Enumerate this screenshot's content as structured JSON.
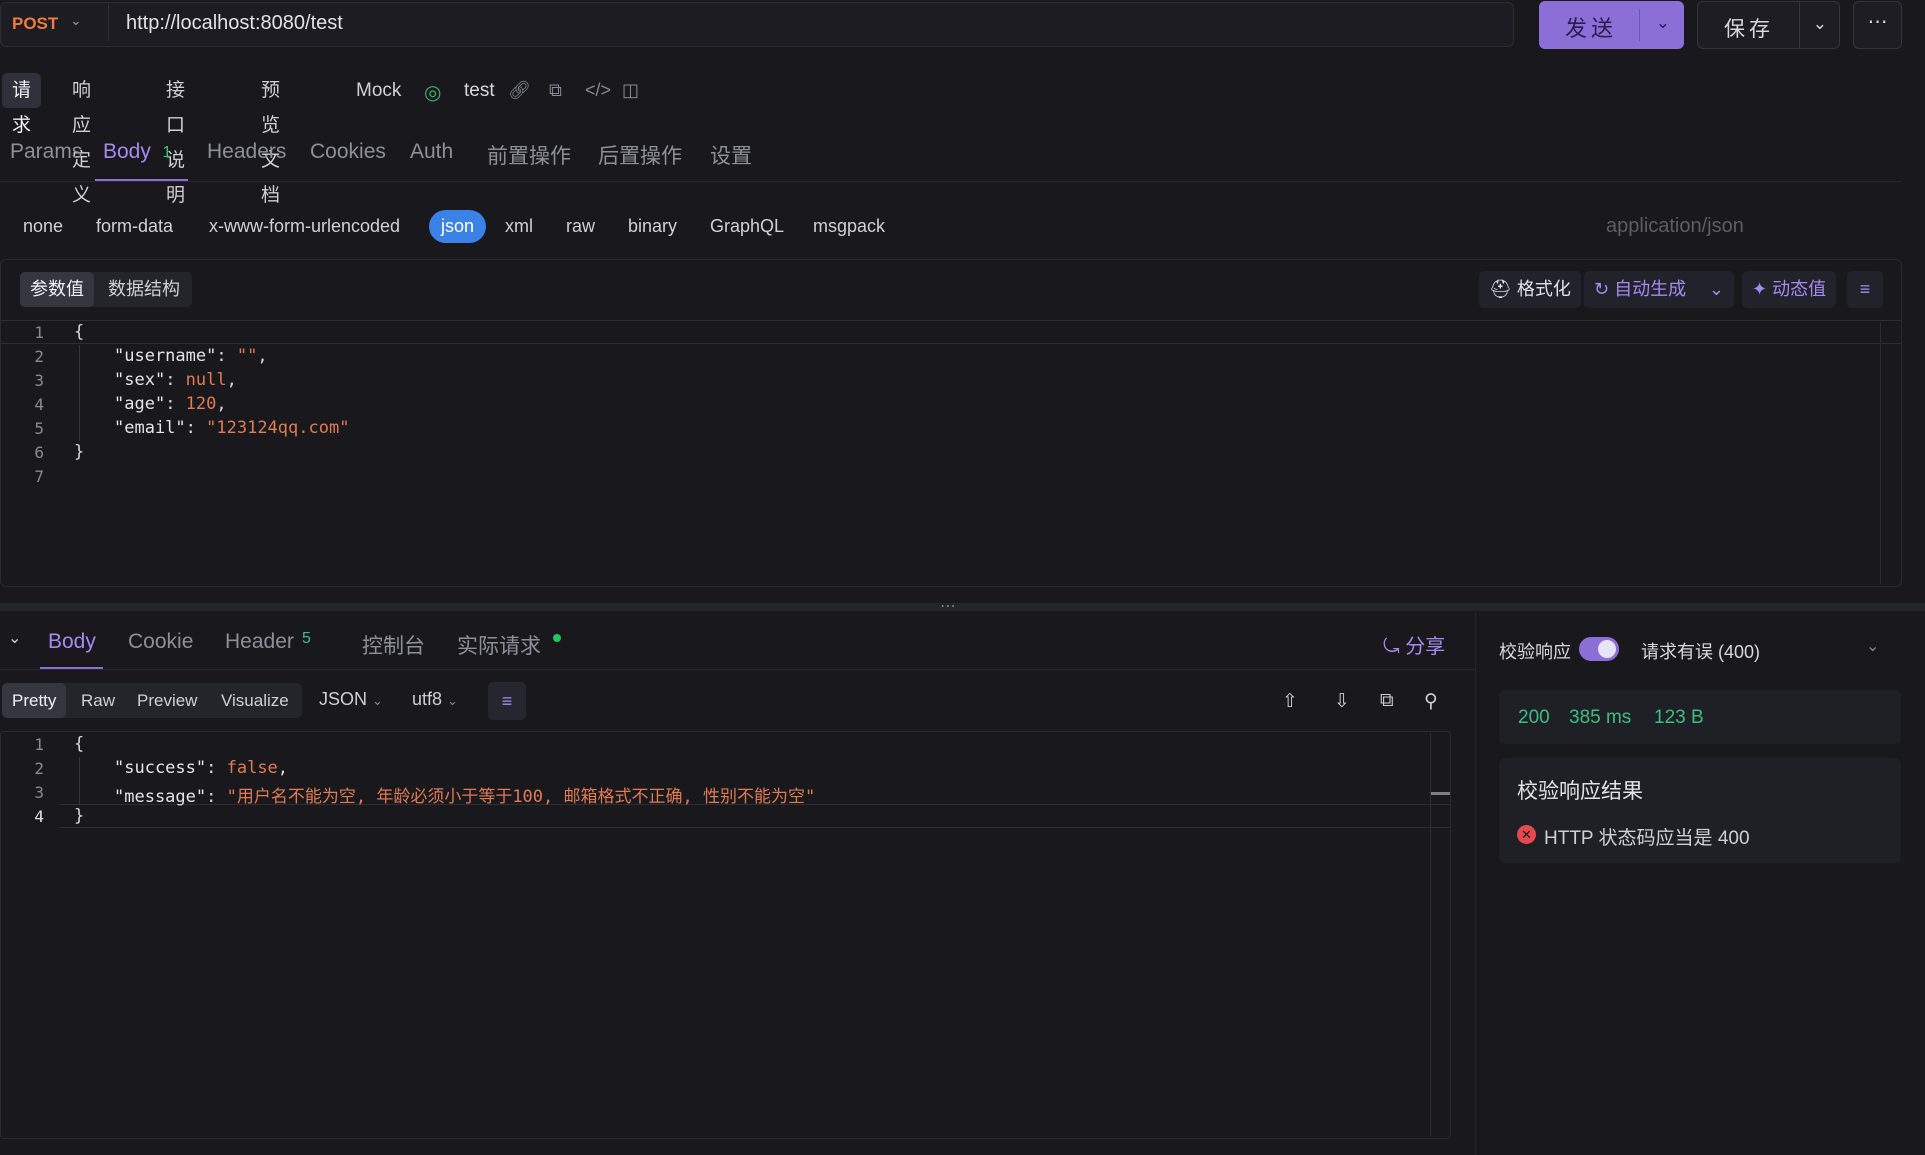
{
  "request": {
    "method": "POST",
    "url": "http://localhost:8080/test",
    "send_label": "发送",
    "save_label": "保存"
  },
  "mode_tabs": [
    "请求",
    "响应定义",
    "接口说明",
    "预览文档",
    "Mock"
  ],
  "environment": {
    "name": "test"
  },
  "request_tabs": {
    "params": "Params",
    "body": "Body",
    "body_count": "1",
    "headers": "Headers",
    "cookies": "Cookies",
    "auth": "Auth",
    "pre": "前置操作",
    "post": "后置操作",
    "settings": "设置"
  },
  "body_types": [
    "none",
    "form-data",
    "x-www-form-urlencoded",
    "json",
    "xml",
    "raw",
    "binary",
    "GraphQL",
    "msgpack"
  ],
  "content_type": "application/json",
  "editor": {
    "view_tabs": [
      "参数值",
      "数据结构"
    ],
    "format_label": "格式化",
    "autogen_label": "自动生成",
    "dynamic_label": "动态值",
    "line_numbers": [
      "1",
      "2",
      "3",
      "4",
      "5",
      "6",
      "7"
    ]
  },
  "request_body": {
    "open": "{",
    "close": "}",
    "username_key": "\"username\"",
    "username_val": "\"\"",
    "sex_key": "\"sex\"",
    "sex_val": "null",
    "age_key": "\"age\"",
    "age_val": "120",
    "email_key": "\"email\"",
    "email_val": "\"123124qq.com\""
  },
  "response_tabs": {
    "body": "Body",
    "cookie": "Cookie",
    "header": "Header",
    "header_count": "5",
    "console": "控制台",
    "actual": "实际请求",
    "share": "分享"
  },
  "response_formats": [
    "Pretty",
    "Raw",
    "Preview",
    "Visualize"
  ],
  "response_lang": "JSON",
  "response_encoding": "utf8",
  "response_lines": [
    "1",
    "2",
    "3",
    "4"
  ],
  "response_body": {
    "open": "{",
    "close": "}",
    "success_key": "\"success\"",
    "success_val": "false",
    "message_key": "\"message\"",
    "message_val": "\"用户名不能为空, 年龄必须小于等于100, 邮箱格式不正确, 性别不能为空\""
  },
  "validation": {
    "label": "校验响应",
    "status_text": "请求有误 (400)",
    "status_code": "200",
    "time": "385 ms",
    "size": "123 B",
    "result_title": "校验响应结果",
    "result_item": "HTTP 状态码应当是 400"
  },
  "colors": {
    "accent": "#8c6fd6",
    "method": "#f07b3f",
    "success": "#3fbf7f",
    "error": "#e5484d",
    "json_chip": "#3b82e6"
  }
}
